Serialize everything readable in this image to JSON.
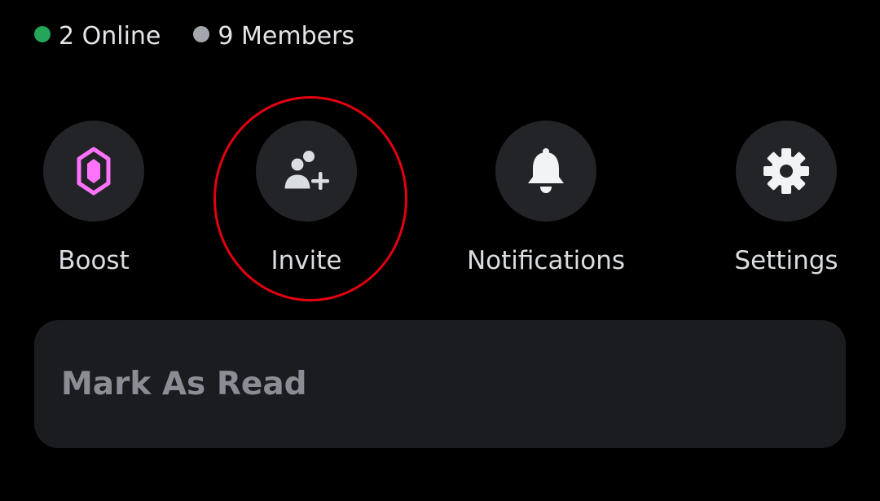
{
  "status": {
    "online_label": "2 Online",
    "members_label": "9 Members",
    "online_color": "#23a55a",
    "members_color": "#a3a6ad"
  },
  "actions": [
    {
      "label": "Boost",
      "icon": "boost-gem-icon",
      "icon_color": "#ff73fa"
    },
    {
      "label": "Invite",
      "icon": "add-member-icon",
      "icon_color": "#dbdee1"
    },
    {
      "label": "Notifications",
      "icon": "bell-icon",
      "icon_color": "#f2f3f5"
    },
    {
      "label": "Settings",
      "icon": "gear-icon",
      "icon_color": "#f2f3f5"
    }
  ],
  "highlight_color": "#e3000f",
  "mark_as_read_label": "Mark As Read"
}
